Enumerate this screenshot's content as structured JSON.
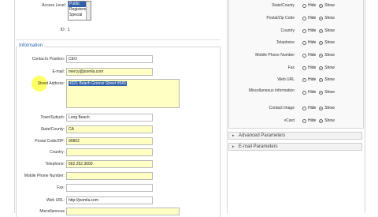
{
  "access": {
    "label": "Access Level:",
    "options": [
      "Public",
      "Registered",
      "Special"
    ]
  },
  "id": {
    "label": "ID:",
    "value": "1"
  },
  "information": {
    "legend": "Information"
  },
  "fields": {
    "position": {
      "label": "Contact's Position:",
      "value": "CEO"
    },
    "email": {
      "label": "E-mail:",
      "value": "mercy@joomla.com"
    },
    "street": {
      "label": "Street Address:",
      "value": "4321 Beach Groove Street #543"
    },
    "town": {
      "label": "Town/Suburb:",
      "value": "Long Beach"
    },
    "state": {
      "label": "State/County:",
      "value": "CA"
    },
    "postal": {
      "label": "Postal Code/ZIP:",
      "value": "90802"
    },
    "country": {
      "label": "Country:",
      "value": ""
    },
    "telephone": {
      "label": "Telephone:",
      "value": "562.252.3000"
    },
    "mobile": {
      "label": "Mobile Phone Number:",
      "value": ""
    },
    "fax": {
      "label": "Fax:",
      "value": ""
    },
    "weburl": {
      "label": "Web URL:",
      "value": "http://joomla.com"
    },
    "misc": {
      "label": "Miscellaneous"
    }
  },
  "right": {
    "hide": "Hide",
    "show": "Show",
    "rows": [
      {
        "label": "State/County"
      },
      {
        "label": "Postal/Zip Code"
      },
      {
        "label": "Country"
      },
      {
        "label": "Telephone"
      },
      {
        "label": "Mobile Phone Number"
      },
      {
        "label": "Fax"
      },
      {
        "label": "Web URL"
      },
      {
        "label": "Miscellaneous Information"
      },
      {
        "label": "Contact Image"
      },
      {
        "label": "vCard"
      }
    ],
    "advanced": "Advanced Parameters",
    "email_params": "E-mail Parameters"
  },
  "colors": {
    "accent": "#2a5db0",
    "highlight": "#ffff66",
    "field_yellow": "#ffffc4",
    "selection": "#2f5fa8"
  }
}
